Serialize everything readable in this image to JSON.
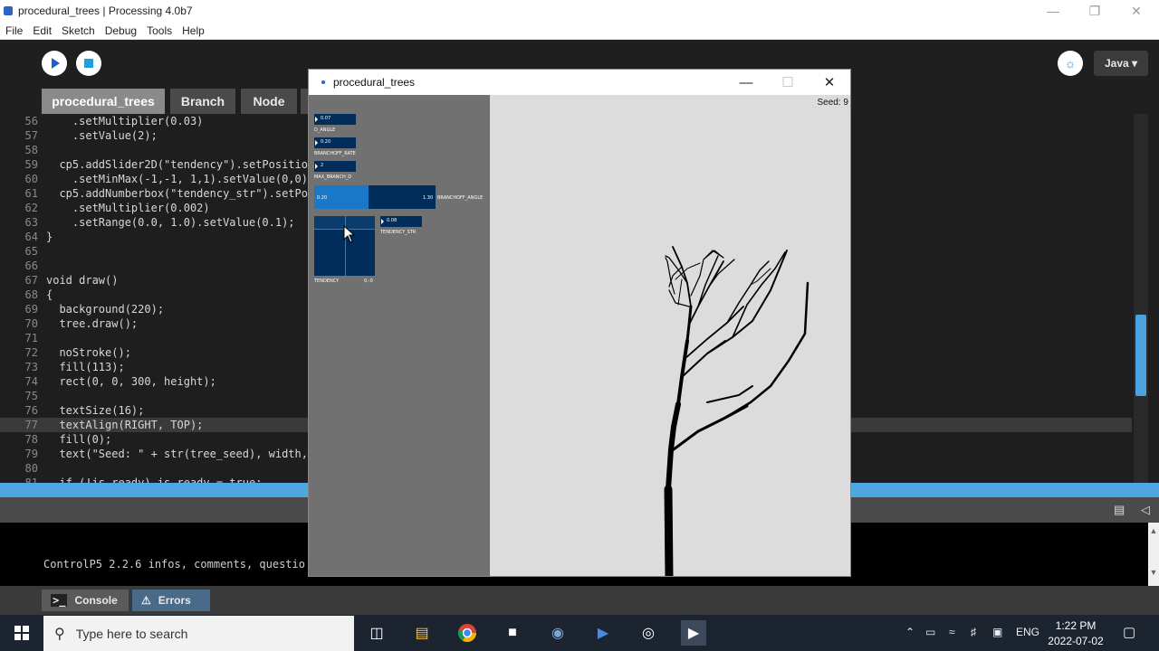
{
  "window": {
    "title": "procedural_trees | Processing 4.0b7"
  },
  "menu": [
    "File",
    "Edit",
    "Sketch",
    "Debug",
    "Tools",
    "Help"
  ],
  "toolbar": {
    "mode": "Java ▾"
  },
  "tabs": [
    "procedural_trees",
    "Branch",
    "Node"
  ],
  "code": [
    {
      "n": "56",
      "t": "    .setMultiplier(0.03)"
    },
    {
      "n": "57",
      "t": "    .setValue(2);"
    },
    {
      "n": "58",
      "t": ""
    },
    {
      "n": "59",
      "t": "  cp5.addSlider2D(\"tendency\").setPosition"
    },
    {
      "n": "60",
      "t": "    .setMinMax(-1,-1, 1,1).setValue(0,0);"
    },
    {
      "n": "61",
      "t": "  cp5.addNumberbox(\"tendency_str\").setPos"
    },
    {
      "n": "62",
      "t": "    .setMultiplier(0.002)"
    },
    {
      "n": "63",
      "t": "    .setRange(0.0, 1.0).setValue(0.1);"
    },
    {
      "n": "64",
      "t": "}"
    },
    {
      "n": "65",
      "t": ""
    },
    {
      "n": "66",
      "t": ""
    },
    {
      "n": "67",
      "t": "void draw()"
    },
    {
      "n": "68",
      "t": "{"
    },
    {
      "n": "69",
      "t": "  background(220);"
    },
    {
      "n": "70",
      "t": "  tree.draw();"
    },
    {
      "n": "71",
      "t": ""
    },
    {
      "n": "72",
      "t": "  noStroke();"
    },
    {
      "n": "73",
      "t": "  fill(113);"
    },
    {
      "n": "74",
      "t": "  rect(0, 0, 300, height);"
    },
    {
      "n": "75",
      "t": ""
    },
    {
      "n": "76",
      "t": "  textSize(16);"
    },
    {
      "n": "77",
      "t": "  textAlign(RIGHT, TOP);"
    },
    {
      "n": "78",
      "t": "  fill(0);"
    },
    {
      "n": "79",
      "t": "  text(\"Seed: \" + str(tree_seed), width, "
    },
    {
      "n": "80",
      "t": ""
    },
    {
      "n": "81",
      "t": "  if (!is_ready) is_ready = true;"
    }
  ],
  "console": {
    "text": "ControlP5 2.2.6 infos, comments, questio"
  },
  "console_tabs": [
    "Console",
    "Errors"
  ],
  "sketch": {
    "title": "procedural_trees",
    "seed": "Seed: 9",
    "controls": {
      "d_angle": {
        "value": "0.07",
        "label": "D_ANGLE"
      },
      "branchoff_rate": {
        "value": "0.20",
        "label": "BRANCHOFF_RATE"
      },
      "max_branch_d": {
        "value": "2",
        "label": "MAX_BRANCH_D"
      },
      "branchoff_angle": {
        "min": "0.20",
        "max": "1.30",
        "label": "BRANCHOFF_ANGLE",
        "fill": 0.45
      },
      "tendency_str": {
        "value": "0.08",
        "label": "TENDENCY_STR"
      },
      "tendency": {
        "label": "TENDENCY",
        "value": "0,-0"
      }
    }
  },
  "taskbar": {
    "search_placeholder": "Type here to search",
    "lang": "ENG",
    "time": "1:22 PM",
    "date": "2022-07-02"
  }
}
